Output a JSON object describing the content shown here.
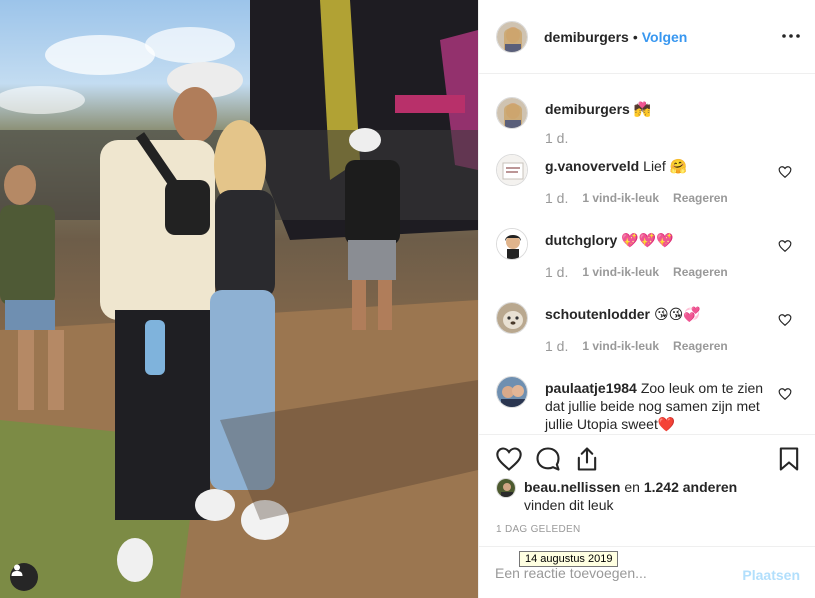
{
  "post": {
    "username": "demiburgers",
    "separator": "•",
    "follow_label": "Volgen",
    "more_icon": "more-horizontal-icon"
  },
  "comments": [
    {
      "author": "demiburgers",
      "text": "💏",
      "age": "1 d.",
      "likes": "",
      "reply": ""
    },
    {
      "author": "g.vanoverveld",
      "text": "Lief 🤗",
      "age": "1 d.",
      "likes": "1 vind-ik-leuk",
      "reply": "Reageren"
    },
    {
      "author": "dutchglory",
      "text": "💖💖💖",
      "age": "1 d.",
      "likes": "1 vind-ik-leuk",
      "reply": "Reageren"
    },
    {
      "author": "schoutenlodder",
      "text": "😘😘💞",
      "age": "1 d.",
      "likes": "1 vind-ik-leuk",
      "reply": "Reageren"
    },
    {
      "author": "paulaatje1984",
      "text": "Zoo leuk om te zien dat jullie beide nog samen zijn met jullie Utopia sweet❤️",
      "age": "",
      "likes": "",
      "reply": ""
    }
  ],
  "likes": {
    "user": "beau.nellissen",
    "and": "en",
    "count": "1.242 anderen",
    "suffix": "vinden dit leuk"
  },
  "posted": "1 DAG GELEDEN",
  "tooltip": "14 augustus 2019",
  "add_comment": {
    "placeholder": "Een reactie toevoegen...",
    "value": "",
    "post_label": "Plaatsen"
  },
  "colors": {
    "link": "#3897f0",
    "muted": "#999999",
    "post_disabled": "#b2dffc",
    "heart_red": "#ed4956"
  }
}
